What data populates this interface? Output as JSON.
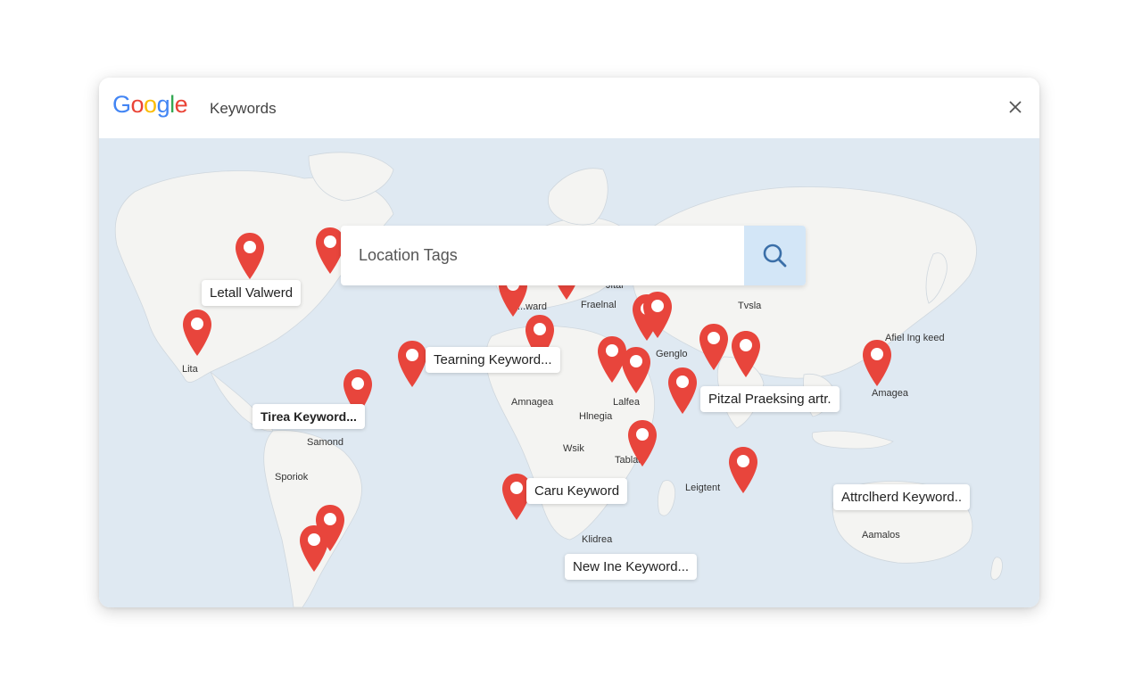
{
  "header": {
    "logo_letters": [
      "G",
      "o",
      "o",
      "g",
      "l",
      "e"
    ],
    "title": "Keywords",
    "close_icon": "close-icon"
  },
  "search": {
    "placeholder": "Location Tags",
    "button_icon": "search-icon"
  },
  "colors": {
    "pin": "#e8453c",
    "ocean": "#dfe9f2",
    "land": "#f4f4f2",
    "search_button": "#d3e6f7"
  },
  "keyword_labels": [
    "Letall Valwerd",
    "Tearning Keyword...",
    "Tirea Keyword...",
    "Pitzal Praeksing artr.",
    "Caru Keyword",
    "Attrclherd Keyword..",
    "New Ine Keyword..."
  ],
  "place_labels": [
    "Lita",
    "Samond",
    "Sporiok",
    "Jital",
    "Fraelnal",
    "Tvsla",
    "Genglo",
    "Lalfea",
    "Amnagea",
    "Hlnegia",
    "Wsik",
    "Tablaa",
    "Leigtent",
    "Klidrea",
    "Afiel Ing keed",
    "Amagea",
    "Aamalos",
    "...ward"
  ]
}
